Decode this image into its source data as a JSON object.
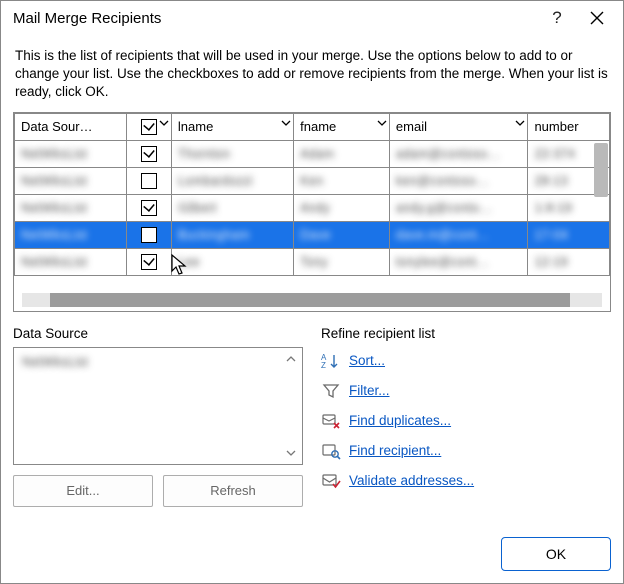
{
  "title": "Mail Merge Recipients",
  "instructions": "This is the list of recipients that will be used in your merge.  Use the options below to add to or change your list.  Use the checkboxes to add or remove recipients from the merge.  When your list is ready, click OK.",
  "columns": {
    "data_source": "Data Sour…",
    "lname": "lname",
    "fname": "fname",
    "email": "email",
    "number": "number"
  },
  "rows": [
    {
      "ds": "NetWksList",
      "checked": true,
      "lname": "Thornton",
      "fname": "Adam",
      "email": "adam@contoso…",
      "number": "22-374",
      "selected": false
    },
    {
      "ds": "NetWksList",
      "checked": false,
      "lname": "Lombardozzi",
      "fname": "Ken",
      "email": "ken@contoso…",
      "number": "28-13",
      "selected": false
    },
    {
      "ds": "NetWksList",
      "checked": true,
      "lname": "Gilbert",
      "fname": "Andy",
      "email": "andy.g@conto…",
      "number": "1-8-19",
      "selected": false
    },
    {
      "ds": "NetWksList",
      "checked": false,
      "lname": "Buckingham",
      "fname": "Dave",
      "email": "dave.m@cont…",
      "number": "17-04",
      "selected": true
    },
    {
      "ds": "NetWksList",
      "checked": true,
      "lname": "Lee",
      "fname": "Tony",
      "email": "tonylee@cont…",
      "number": "12-19",
      "selected": false
    }
  ],
  "data_source": {
    "label": "Data Source",
    "items": [
      "NetWksList"
    ],
    "edit": "Edit...",
    "refresh": "Refresh"
  },
  "refine": {
    "label": "Refine recipient list",
    "sort": "Sort...",
    "filter": "Filter...",
    "find_duplicates": "Find duplicates...",
    "find_recipient": "Find recipient...",
    "validate": "Validate addresses..."
  },
  "ok": "OK"
}
